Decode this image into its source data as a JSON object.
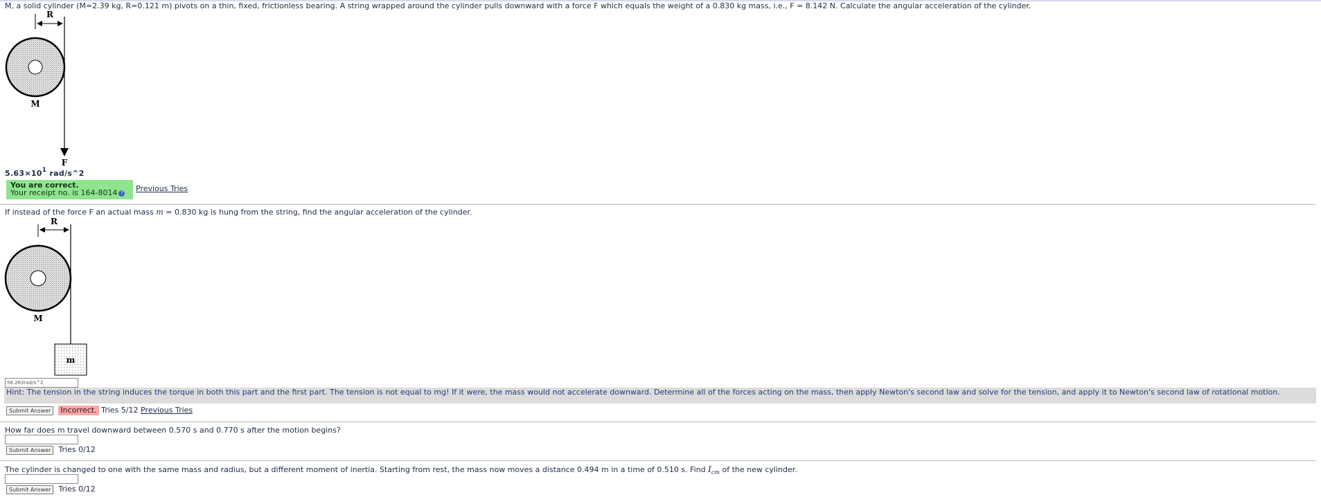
{
  "q1": {
    "text": "M, a solid cylinder (M=2.39 kg, R=0.121 m) pivots on a thin, fixed, frictionless bearing. A string wrapped around the cylinder pulls downward with a force F which equals the weight of a 0.830 kg mass, i.e., F = 8.142 N. Calculate the angular acceleration of the cylinder.",
    "fig_label_R": "R",
    "fig_label_M": "M",
    "fig_label_F": "F",
    "answer_mantissa": "5.63×10",
    "answer_exponent": "1",
    "answer_units": " rad/s^2",
    "correct_title": "You are correct.",
    "receipt": "Your receipt no. is 164-8014",
    "previous_tries": "Previous Tries"
  },
  "q2": {
    "text_before": "If instead of the force F an actual mass ",
    "text_var": "m",
    "text_after": " = 0.830 kg is hung from the string, find the angular acceleration of the cylinder.",
    "fig_label_R": "R",
    "fig_label_M": "M",
    "fig_label_m": "m",
    "input_value": "56.263rad/s^2",
    "hint": "Hint: The tension in the string induces the torque in both this part and the first part. The tension is not equal to mg! If it were, the mass would not accelerate downward. Determine all of the forces acting on the mass, then apply Newton's second law and solve for the tension, and apply it to Newton's second law of rotational motion.",
    "submit_label": "Submit Answer",
    "status": "Incorrect.",
    "tries": " Tries 5/12 ",
    "previous_tries": "Previous Tries"
  },
  "q3": {
    "text": "How far does m travel downward between 0.570 s and 0.770 s after the motion begins?",
    "input_value": "",
    "submit_label": "Submit Answer",
    "tries": "Tries 0/12"
  },
  "q4": {
    "text_before": "The cylinder is changed to one with the same mass and radius, but a different moment of inertia. Starting from rest, the mass now moves a distance 0.494 m in a time of 0.510 s. Find ",
    "text_var": "I",
    "text_sub": "cm",
    "text_after": " of the new cylinder.",
    "input_value": "",
    "submit_label": "Submit Answer",
    "tries": "Tries 0/12"
  },
  "colors": {
    "correct_bg": "#8fe58f",
    "incorrect_bg": "#f7a8a8",
    "hint_bg": "#dcdcdc",
    "text": "#1f2a44"
  }
}
